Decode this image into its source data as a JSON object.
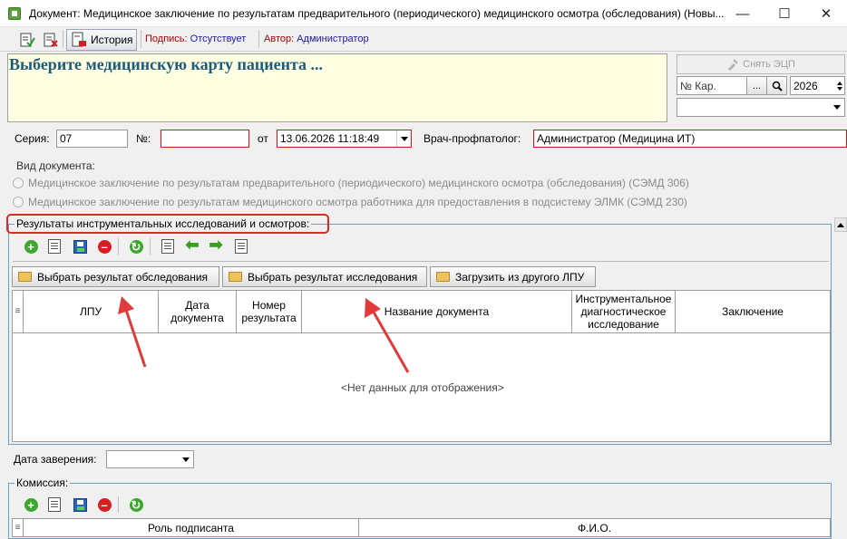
{
  "window": {
    "title": "Документ: Медицинское заключение по результатам предварительного (периодического) медицинского осмотра (обследования) (Новы...",
    "minimize": "—",
    "maximize": "☐",
    "close": "✕"
  },
  "toolbar": {
    "history_label": "История",
    "sign_label": "Подпись:",
    "sign_value": "Отсутствует",
    "author_label": "Автор:",
    "author_value": "Администратор"
  },
  "patient": {
    "title": "Выберите медицинскую карту пациента ...",
    "remove_sign_label": "Снять ЭЦП",
    "card_placeholder": "№ Кар.",
    "card_browse": "...",
    "year_value": "2026"
  },
  "document": {
    "series_label": "Серия:",
    "series_value": "07",
    "number_label": "№:",
    "number_value": "",
    "date_label": "от",
    "date_value": "13.06.2026 11:18:49",
    "doctor_label": "Врач-профпатолог:",
    "doctor_value": "Администратор (Медицина ИТ)",
    "doc_type_label": "Вид документа:",
    "doc_type_options": [
      "Медицинское заключение по результатам предварительного (периодического) медицинского осмотра (обследования) (СЭМД 306)",
      "Медицинское заключение по результатам медицинского осмотра работника для предоставления в подсистему ЭЛМК (СЭМД 230)"
    ]
  },
  "results": {
    "caption": "Результаты инструментальных исследований и осмотров:",
    "buttons": {
      "select_exam": "Выбрать результат обследования",
      "select_study": "Выбрать результат исследования",
      "load_other": "Загрузить из другого ЛПУ"
    },
    "columns": {
      "lpu": "ЛПУ",
      "doc_date": "Дата документа",
      "result_number": "Номер результата",
      "doc_name": "Название документа",
      "instrumental": "Инструментальное диагностическое исследование",
      "conclusion": "Заключение"
    },
    "empty": "<Нет данных для отображения>"
  },
  "certify": {
    "label": "Дата заверения:",
    "value": ""
  },
  "commission": {
    "caption": "Комиссия:",
    "columns": {
      "role": "Роль подписанта",
      "fio": "Ф.И.О."
    }
  }
}
